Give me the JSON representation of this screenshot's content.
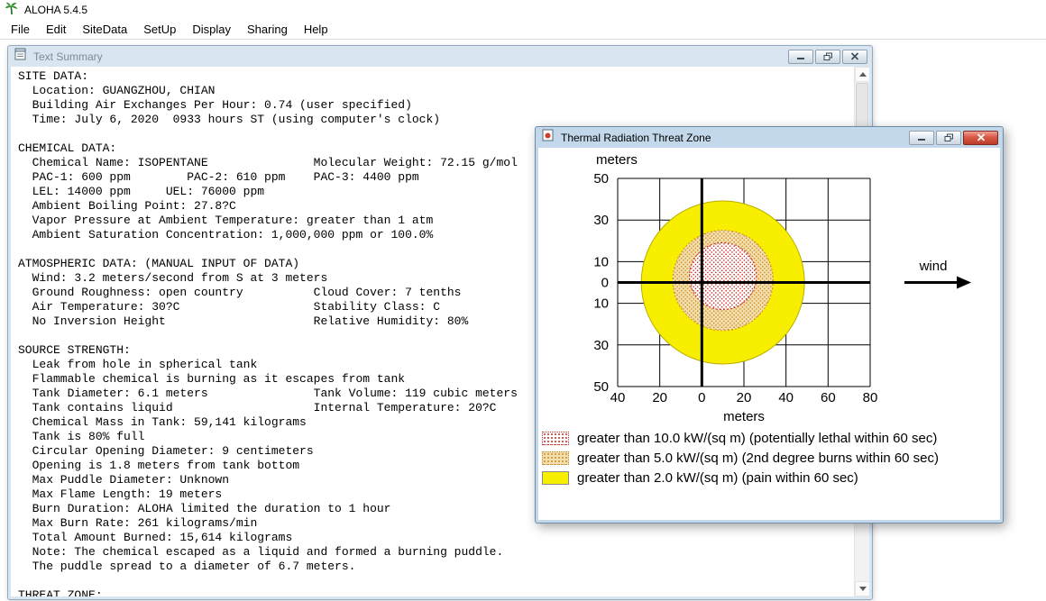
{
  "app": {
    "title": "ALOHA 5.4.5",
    "menu_items": [
      "File",
      "Edit",
      "SiteData",
      "SetUp",
      "Display",
      "Sharing",
      "Help"
    ]
  },
  "text_summary_window": {
    "title": "Text Summary",
    "lines": [
      "SITE DATA:",
      "  Location: GUANGZHOU, CHIAN",
      "  Building Air Exchanges Per Hour: 0.74 (user specified)",
      "  Time: July 6, 2020  0933 hours ST (using computer's clock)",
      "",
      "CHEMICAL DATA:",
      "  Chemical Name: ISOPENTANE               Molecular Weight: 72.15 g/mol",
      "  PAC-1: 600 ppm        PAC-2: 610 ppm    PAC-3: 4400 ppm",
      "  LEL: 14000 ppm     UEL: 76000 ppm",
      "  Ambient Boiling Point: 27.8?C",
      "  Vapor Pressure at Ambient Temperature: greater than 1 atm",
      "  Ambient Saturation Concentration: 1,000,000 ppm or 100.0%",
      "",
      "ATMOSPHERIC DATA: (MANUAL INPUT OF DATA)",
      "  Wind: 3.2 meters/second from S at 3 meters",
      "  Ground Roughness: open country          Cloud Cover: 7 tenths",
      "  Air Temperature: 30?C                   Stability Class: C",
      "  No Inversion Height                     Relative Humidity: 80%",
      "",
      "SOURCE STRENGTH:",
      "  Leak from hole in spherical tank",
      "  Flammable chemical is burning as it escapes from tank",
      "  Tank Diameter: 6.1 meters               Tank Volume: 119 cubic meters",
      "  Tank contains liquid                    Internal Temperature: 20?C",
      "  Chemical Mass in Tank: 59,141 kilograms",
      "  Tank is 80% full",
      "  Circular Opening Diameter: 9 centimeters",
      "  Opening is 1.8 meters from tank bottom",
      "  Max Puddle Diameter: Unknown",
      "  Max Flame Length: 19 meters",
      "  Burn Duration: ALOHA limited the duration to 1 hour",
      "  Max Burn Rate: 261 kilograms/min",
      "  Total Amount Burned: 15,614 kilograms",
      "  Note: The chemical escaped as a liquid and formed a burning puddle.",
      "  The puddle spread to a diameter of 6.7 meters.",
      "",
      "THREAT ZONE:"
    ]
  },
  "threat_window": {
    "title": "Thermal Radiation Threat Zone",
    "legend": [
      {
        "label": "greater than 10.0 kW/(sq m) (potentially lethal within 60 sec)",
        "swatch": "red-dots"
      },
      {
        "label": "greater than 5.0 kW/(sq m) (2nd degree burns within 60 sec)",
        "swatch": "tan-dots"
      },
      {
        "label": "greater than 2.0 kW/(sq m) (pain within 60 sec)",
        "swatch": "yellow"
      }
    ]
  },
  "chart_data": {
    "type": "threat_zone_plot",
    "title": "Thermal Radiation Threat Zone",
    "xlabel": "meters",
    "ylabel": "meters",
    "xlim": [
      -40,
      80
    ],
    "ylim": [
      -50,
      50
    ],
    "grid": true,
    "x_gridlines": [
      -40,
      -20,
      0,
      20,
      40,
      60,
      80
    ],
    "y_gridlines": [
      50,
      30,
      10,
      -10,
      -30,
      -50
    ],
    "x_tick_labels": [
      "40",
      "20",
      "0",
      "20",
      "40",
      "60",
      "80"
    ],
    "y_tick_values": [
      50,
      30,
      10,
      0,
      -10,
      -30,
      -50
    ],
    "y_tick_labels": [
      "50",
      "30",
      "10",
      "0",
      "10",
      "30",
      "50"
    ],
    "origin_crosshair": true,
    "wind": {
      "label": "wind",
      "direction": "toward +x (east)"
    },
    "zones": [
      {
        "threshold": "greater than 2.0 kW/(sq m)",
        "effect": "pain within 60 sec",
        "center_x": 10,
        "center_y": 0,
        "radius_m": 39,
        "style": "yellow"
      },
      {
        "threshold": "greater than 5.0 kW/(sq m)",
        "effect": "2nd degree burns within 60 sec",
        "center_x": 10,
        "center_y": 1,
        "radius_m": 24,
        "style": "tan-dots"
      },
      {
        "threshold": "greater than 10.0 kW/(sq m)",
        "effect": "potentially lethal within 60 sec",
        "center_x": 10,
        "center_y": 3,
        "radius_m": 16,
        "style": "red-dots"
      }
    ],
    "legend_position": "bottom"
  },
  "colors": {
    "zone_yellow": "#f8ef00",
    "zone_yellow_edge": "#b8ae00",
    "zone_tan": "#f2dfae",
    "zone_tan_dot": "#d08a20",
    "zone_red_dot": "#c62a22",
    "grid_line": "#000000",
    "close_button_red": "#bb3a28"
  }
}
